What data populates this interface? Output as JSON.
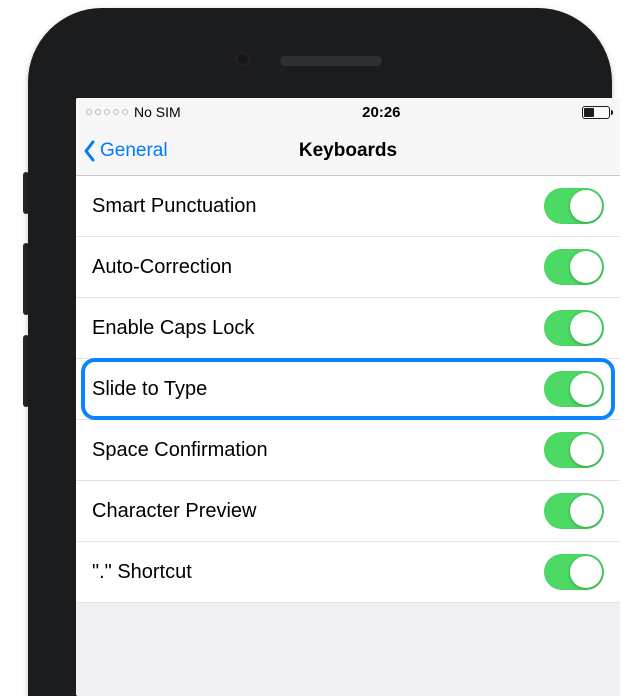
{
  "status": {
    "carrier": "No SIM",
    "time": "20:26"
  },
  "nav": {
    "back_label": "General",
    "title": "Keyboards"
  },
  "rows": {
    "r0": "Smart Punctuation",
    "r1": "Auto-Correction",
    "r2": "Enable Caps Lock",
    "r3": "Slide to Type",
    "r4": "Space Confirmation",
    "r5": "Character Preview",
    "r6": "\".\" Shortcut"
  }
}
